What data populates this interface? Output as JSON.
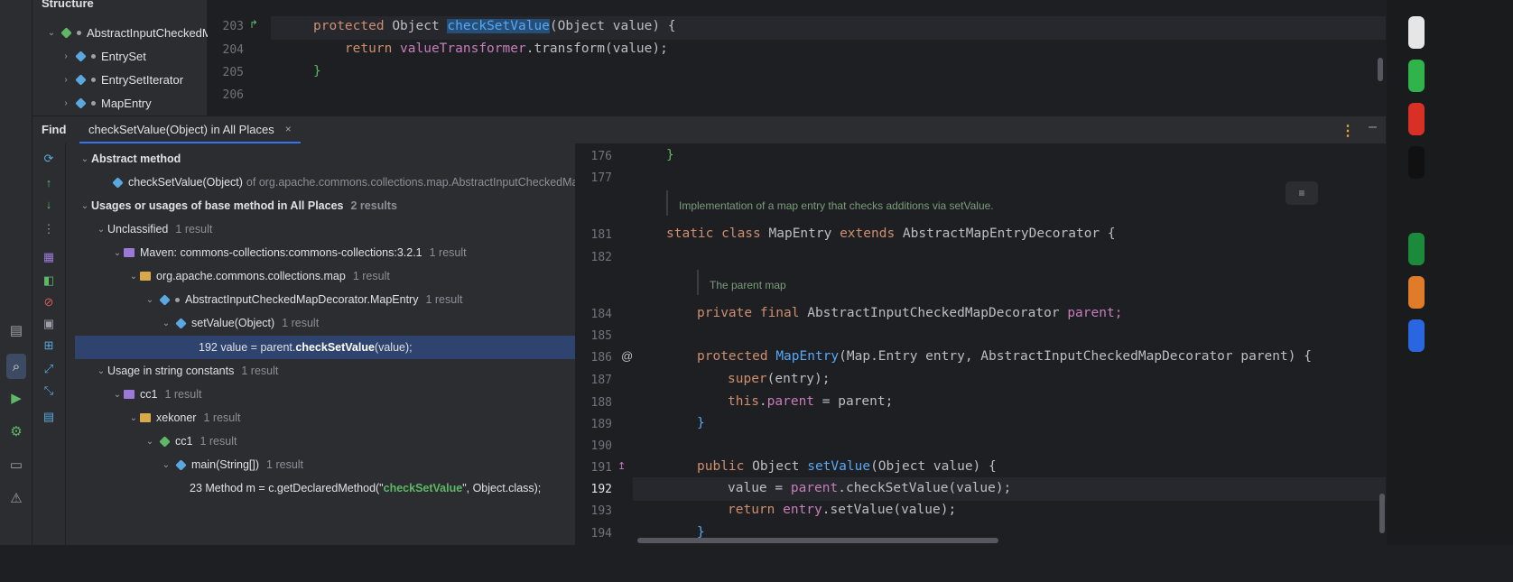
{
  "structure": {
    "title": "Structure",
    "items": [
      {
        "label": "AbstractInputCheckedM"
      },
      {
        "label": "EntrySet"
      },
      {
        "label": "EntrySetIterator"
      },
      {
        "label": "MapEntry"
      }
    ]
  },
  "top_editor": {
    "lines": [
      {
        "num": "203",
        "text": "protected Object checkSetValue(Object value) {"
      },
      {
        "num": "204",
        "text": "    return valueTransformer.transform(value);"
      },
      {
        "num": "205",
        "text": "}"
      },
      {
        "num": "206",
        "text": ""
      }
    ]
  },
  "find": {
    "title": "Find",
    "tab_label": "checkSetValue(Object) in All Places",
    "tab_close": "×"
  },
  "tree": {
    "abstract_method": "Abstract method",
    "abstract_item": "checkSetValue(Object)",
    "abstract_item_suffix": "of org.apache.commons.collections.map.AbstractInputCheckedMa",
    "usages_header": "Usages or usages of base method in All Places",
    "usages_count": "2 results",
    "unclassified": "Unclassified",
    "unclassified_count": "1 result",
    "maven": "Maven: commons-collections:commons-collections:3.2.1",
    "maven_count": "1 result",
    "package": "org.apache.commons.collections.map",
    "package_count": "1 result",
    "class": "AbstractInputCheckedMapDecorator.MapEntry",
    "class_count": "1 result",
    "method": "setValue(Object)",
    "method_count": "1 result",
    "usage_line_prefix": "192 value = parent.",
    "usage_line_match": "checkSetValue",
    "usage_line_suffix": "(value);",
    "string_constants": "Usage in string constants",
    "string_constants_count": "1 result",
    "cc1_pkg": "cc1",
    "cc1_pkg_count": "1 result",
    "xekoner": "xekoner",
    "xekoner_count": "1 result",
    "cc1_class": "cc1",
    "cc1_class_count": "1 result",
    "main": "main(String[])",
    "main_count": "1 result",
    "main_line_prefix": "23 Method m = c.getDeclaredMethod(\"",
    "main_line_match": "checkSetValue",
    "main_line_suffix": "\", Object.class);"
  },
  "bottom_editor": {
    "nums": [
      "176",
      "177",
      "181",
      "182",
      "184",
      "185",
      "186",
      "187",
      "188",
      "189",
      "190",
      "191",
      "192",
      "193",
      "194"
    ],
    "l176": "}",
    "doc1": "Implementation of a map entry that checks additions via setValue.",
    "l181a": "static class ",
    "l181b": "MapEntry ",
    "l181c": "extends ",
    "l181d": "AbstractMapEntryDecorator {",
    "doc2": "The parent map",
    "l184a": "private final ",
    "l184b": "AbstractInputCheckedMapDecorator ",
    "l184c": "parent;",
    "l186a": "protected ",
    "l186b": "MapEntry",
    "l186c": "(Map.Entry entry, AbstractInputCheckedMapDecorator parent) {",
    "l187a": "super",
    "l187b": "(entry);",
    "l188a": "this",
    "l188b": ".",
    "l188c": "parent",
    "l188d": " = parent;",
    "l189": "}",
    "l191a": "public ",
    "l191b": "Object ",
    "l191c": "setValue",
    "l191d": "(Object value) {",
    "l192a": "value = ",
    "l192b": "parent",
    "l192c": ".checkSetValue(value);",
    "l193a": "return ",
    "l193b": "entry",
    "l193c": ".setValue(value);",
    "l194": "}",
    "at_marker": "@"
  },
  "colors": {
    "accent": "#3574f0",
    "selection": "#2e436e",
    "keyword": "#cf8e6d",
    "function": "#56a8f5",
    "field": "#c77dbb"
  }
}
